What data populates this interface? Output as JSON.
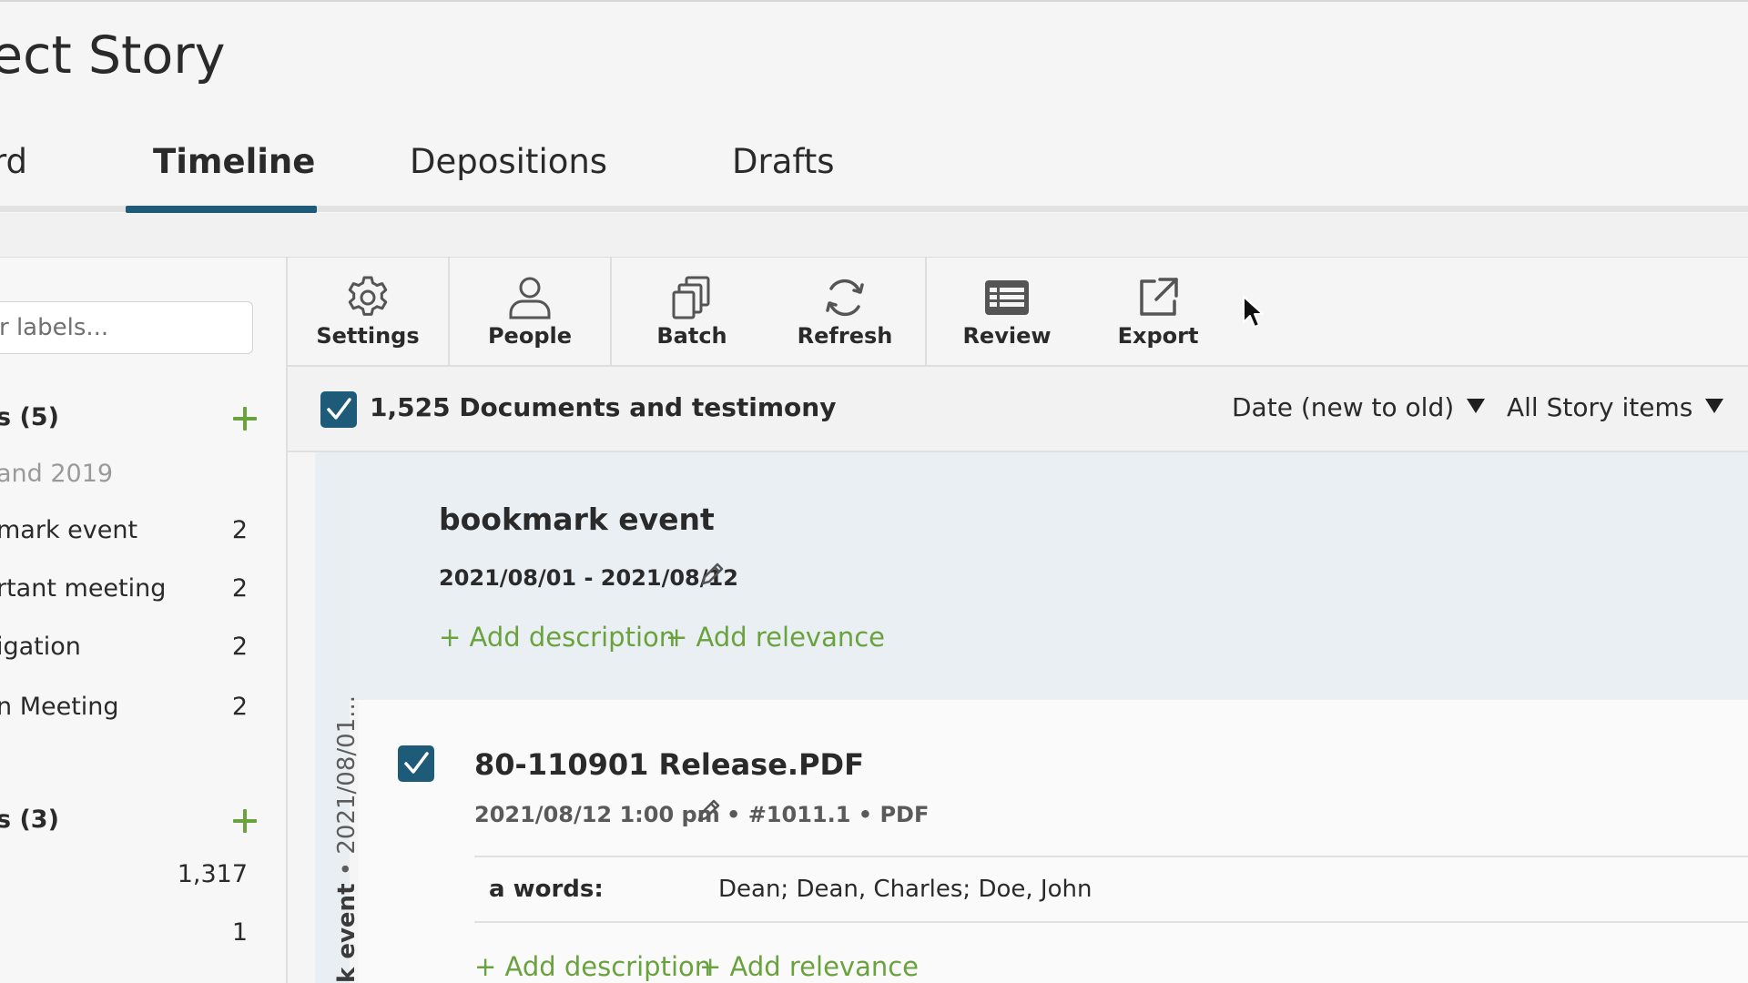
{
  "header": {
    "title": "ect Story"
  },
  "tabs": [
    {
      "label": "rd",
      "active": false
    },
    {
      "label": "Timeline",
      "active": true
    },
    {
      "label": "Depositions",
      "active": false
    },
    {
      "label": "Drafts",
      "active": false
    }
  ],
  "sidebar": {
    "filter_placeholder": "r labels...",
    "section1": {
      "title": "s (5)",
      "subtitle": "and 2019",
      "items": [
        {
          "label": "mark event",
          "count": "2"
        },
        {
          "label": "rtant meeting",
          "count": "2"
        },
        {
          "label": "igation",
          "count": "2"
        },
        {
          "label": "n Meeting",
          "count": "2"
        }
      ]
    },
    "section2": {
      "title": "s (3)",
      "items": [
        {
          "label": "",
          "count": "1,317"
        },
        {
          "label": "",
          "count": "1"
        }
      ]
    }
  },
  "toolbar": {
    "buttons": [
      {
        "label": "Settings",
        "icon": "gear-icon"
      },
      {
        "label": "People",
        "icon": "person-icon"
      },
      {
        "label": "Batch",
        "icon": "batch-copy-icon"
      },
      {
        "label": "Refresh",
        "icon": "refresh-icon"
      },
      {
        "label": "Review",
        "icon": "review-table-icon"
      },
      {
        "label": "Export",
        "icon": "export-icon"
      }
    ]
  },
  "filterbar": {
    "select_all_checked": true,
    "count_label": "1,525 Documents and testimony",
    "sort_label": "Date (new to old)",
    "items_filter_label": "All Story items"
  },
  "rail": {
    "event_name": "k event",
    "separator": " • ",
    "date": "2021/08/01..."
  },
  "event": {
    "title": "bookmark event",
    "date_range": "2021/08/01 - 2021/08/12",
    "add_description": "+ Add description",
    "add_relevance": "+ Add relevance"
  },
  "document": {
    "checked": true,
    "title": "80-110901 Release.PDF",
    "datetime": "2021/08/12 1:00 pm",
    "meta_rest": "• #1011.1 • PDF",
    "keywords_label": "a words:",
    "keywords_value": "Dean; Dean, Charles; Doe, John",
    "add_description": "+ Add description",
    "add_relevance": "+ Add relevance"
  },
  "colors": {
    "accent": "#1d5b78",
    "link_green": "#6aa23e",
    "event_bg": "#e9eff3"
  }
}
